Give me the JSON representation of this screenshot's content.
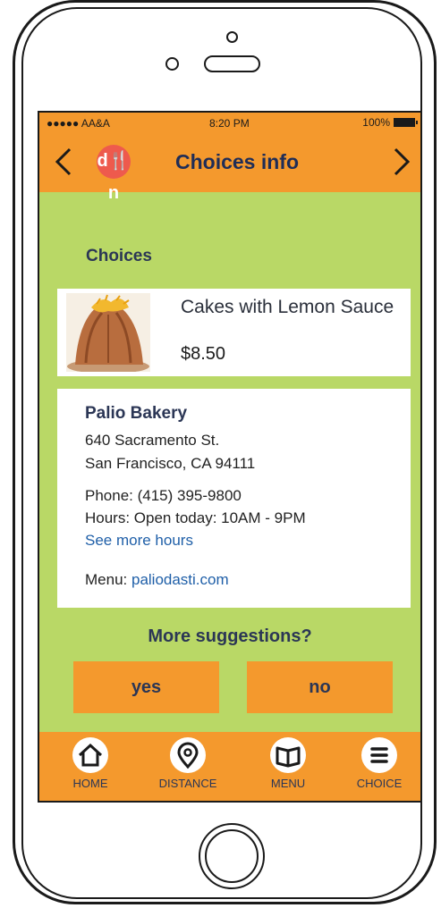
{
  "status": {
    "carrier": "●●●●● AA&A",
    "time": "8:20 PM",
    "battery": "100%"
  },
  "header": {
    "logo": "d🍴n",
    "title": "Choices info"
  },
  "section": {
    "title": "Choices"
  },
  "item": {
    "name": "Cakes with Lemon Sauce",
    "price": "$8.50"
  },
  "place": {
    "name": "Palio Bakery",
    "address1": "640 Sacramento St.",
    "address2": "San Francisco, CA 94111",
    "phone": "Phone: (415) 395-9800",
    "hours": "Hours: Open today: 10AM - 9PM",
    "more_hours": "See more hours",
    "menu_label": "Menu:",
    "menu_link": "paliodasti.com"
  },
  "suggestions": {
    "question": "More suggestions?",
    "yes": "yes",
    "no": "no"
  },
  "tabs": [
    {
      "label": "HOME",
      "icon": "home-icon"
    },
    {
      "label": "DISTANCE",
      "icon": "location-pin-icon"
    },
    {
      "label": "MENU",
      "icon": "book-icon"
    },
    {
      "label": "CHOICE",
      "icon": "list-icon"
    }
  ],
  "colors": {
    "accent": "#f4992d",
    "background": "#b9d866",
    "logo": "#ee5a4d",
    "link": "#1f5fa8",
    "text": "#2b3655"
  }
}
